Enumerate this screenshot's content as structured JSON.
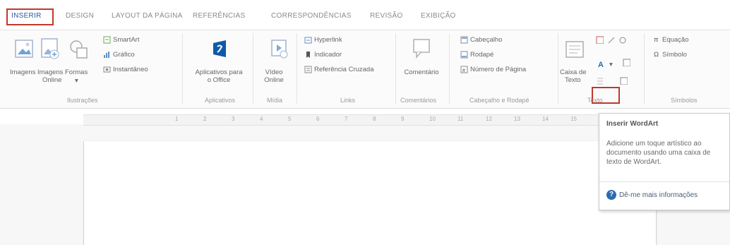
{
  "tabs": [
    {
      "label": "INSERIR",
      "active": true
    },
    {
      "label": "DESIGN"
    },
    {
      "label": "LAYOUT DA PÁGINA"
    },
    {
      "label": "REFERÊNCIAS"
    },
    {
      "label": "CORRESPONDÊNCIAS"
    },
    {
      "label": "REVISÃO"
    },
    {
      "label": "EXIBIÇÃO"
    }
  ],
  "ribbon": {
    "illustrations": {
      "group_label": "Ilustrações",
      "imagens": "Imagens",
      "imagens_online_1": "Imagens",
      "imagens_online_2": "Online",
      "formas": "Formas",
      "smartart": "SmartArt",
      "grafico": "Gráfico",
      "instantaneo": "Instantâneo"
    },
    "apps": {
      "group_label": "Aplicativos",
      "label_1": "Aplicativos para",
      "label_2": "o Office"
    },
    "media": {
      "group_label": "Mídia",
      "label_1": "Vídeo",
      "label_2": "Online"
    },
    "links": {
      "group_label": "Links",
      "hyperlink": "Hyperlink",
      "indicador": "Indicador",
      "referencia": "Referência Cruzada"
    },
    "comments": {
      "group_label": "Comentários",
      "comentario": "Comentário"
    },
    "header_footer": {
      "group_label": "Cabeçalho e Rodapé",
      "cabecalho": "Cabeçalho",
      "rodape": "Rodapé",
      "numero": "Número de Página"
    },
    "text": {
      "group_label": "Texto",
      "caixa_1": "Caixa de",
      "caixa_2": "Texto"
    },
    "symbols": {
      "group_label": "Símbolos",
      "equacao": "Equação",
      "simbolo": "Símbolo"
    }
  },
  "ruler": [
    "1",
    "2",
    "3",
    "4",
    "5",
    "6",
    "7",
    "8",
    "9",
    "10",
    "11",
    "12",
    "13",
    "14",
    "15"
  ],
  "tooltip": {
    "title": "Inserir WordArt",
    "body": "Adicione um toque artístico ao documento usando uma caixa de texto de WordArt.",
    "more": "Dê-me mais informações",
    "help_glyph": "?"
  },
  "colors": {
    "accent": "#2b579a",
    "highlight": "#c0392b"
  }
}
